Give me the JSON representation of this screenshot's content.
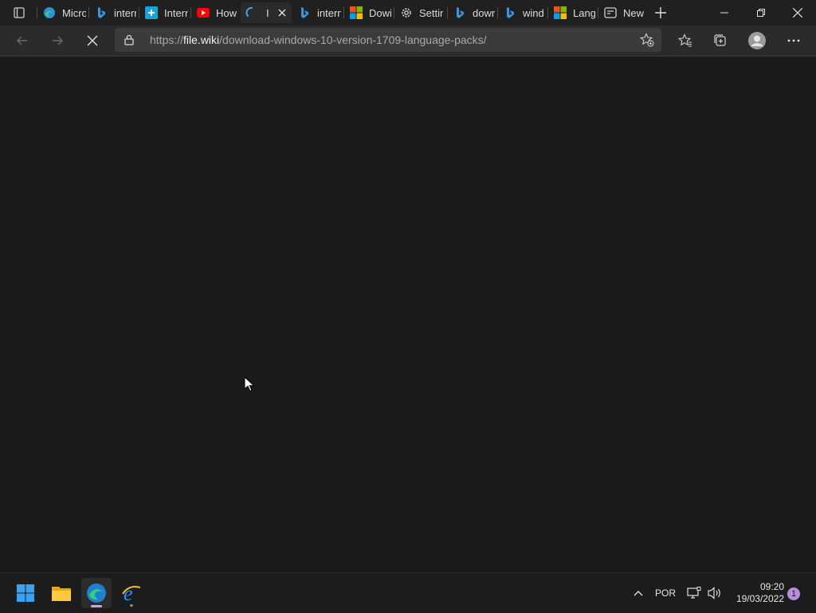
{
  "browser": {
    "tabs": [
      {
        "title": "Micro",
        "icon": "edge-icon"
      },
      {
        "title": "intern",
        "icon": "bing-icon"
      },
      {
        "title": "Intern",
        "icon": "translate-icon"
      },
      {
        "title": "How",
        "icon": "youtube-icon"
      },
      {
        "title": "I",
        "icon": "loading-icon",
        "active": true
      },
      {
        "title": "intern",
        "icon": "bing-icon"
      },
      {
        "title": "Dowi",
        "icon": "microsoft-icon"
      },
      {
        "title": "Settir",
        "icon": "gear-icon"
      },
      {
        "title": "dowr",
        "icon": "bing-icon"
      },
      {
        "title": "wind",
        "icon": "bing-icon"
      },
      {
        "title": "Lang",
        "icon": "microsoft-icon"
      },
      {
        "title": "New",
        "icon": "newtab-icon"
      }
    ],
    "address": {
      "scheme": "https://",
      "domain": "file.wiki",
      "path": "/download-windows-10-version-1709-language-packs/"
    },
    "accent": "#0078d4"
  },
  "taskbar": {
    "language": "POR",
    "time": "09:20",
    "date": "19/03/2022",
    "notification_count": "1"
  }
}
